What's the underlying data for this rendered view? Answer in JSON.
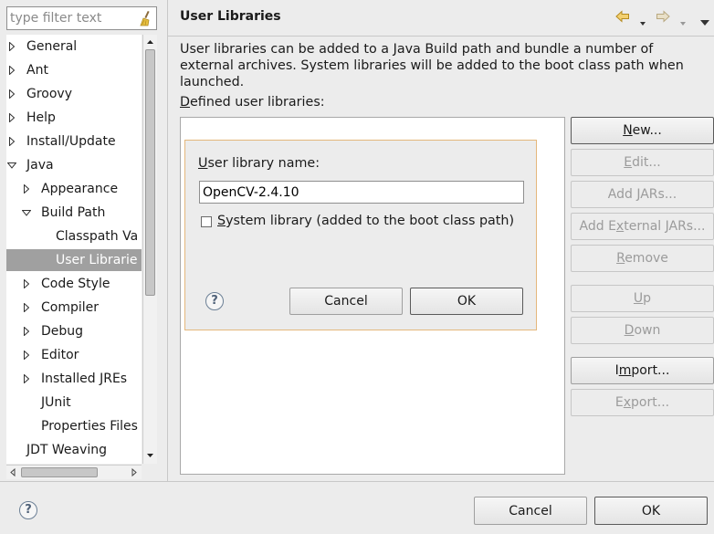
{
  "filter": {
    "placeholder": "type filter text",
    "value": ""
  },
  "tree": {
    "items": [
      {
        "label": "General"
      },
      {
        "label": "Ant"
      },
      {
        "label": "Groovy"
      },
      {
        "label": "Help"
      },
      {
        "label": "Install/Update"
      },
      {
        "label": "Java"
      },
      {
        "label": "Appearance"
      },
      {
        "label": "Build Path"
      },
      {
        "label": "Classpath Va"
      },
      {
        "label": "User Librarie"
      },
      {
        "label": "Code Style"
      },
      {
        "label": "Compiler"
      },
      {
        "label": "Debug"
      },
      {
        "label": "Editor"
      },
      {
        "label": "Installed JREs"
      },
      {
        "label": "JUnit"
      },
      {
        "label": "Properties Files"
      },
      {
        "label": "JDT Weaving"
      }
    ]
  },
  "header": {
    "title": "User Libraries"
  },
  "page": {
    "description": "User libraries can be added to a Java Build path and bundle a number of external archives. System libraries will be added to the boot class path when launched.",
    "defined_label": "Defined user libraries:",
    "defined_mnemonic": "D",
    "defined_rest": "efined user libraries:"
  },
  "side_buttons": [
    {
      "label": "New...",
      "enabled": true
    },
    {
      "label": "Edit...",
      "enabled": false
    },
    {
      "label": "Add JARs...",
      "enabled": false
    },
    {
      "label": "Add External JARs...",
      "enabled": false
    },
    {
      "label": "Remove",
      "enabled": false
    },
    {
      "label": "Up",
      "enabled": false
    },
    {
      "label": "Down",
      "enabled": false
    },
    {
      "label": "Import...",
      "enabled": true
    },
    {
      "label": "Export...",
      "enabled": false
    }
  ],
  "dialog": {
    "name_label": "User library name:",
    "name_value": "OpenCV-2.4.10",
    "system_library_label": "System library (added to the boot class path)",
    "system_library_checked": false,
    "cancel_label": "Cancel",
    "ok_label": "OK",
    "help_symbol": "?"
  },
  "footer": {
    "help_symbol": "?",
    "cancel_label": "Cancel",
    "ok_label": "OK"
  },
  "colors": {
    "selection": "#a0a0a0",
    "dialog_border": "#e4b77c",
    "nav_arrow": "#e0b040"
  }
}
